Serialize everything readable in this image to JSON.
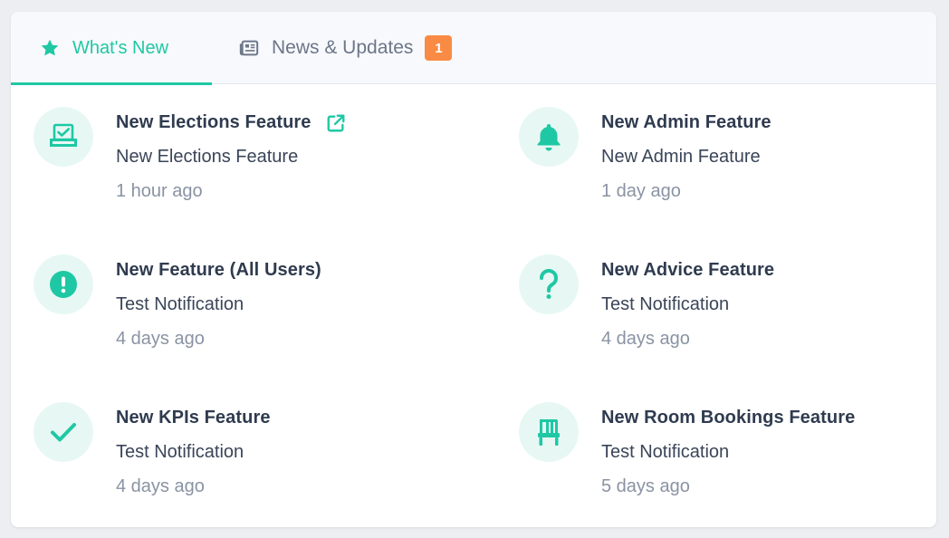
{
  "tabs": {
    "whats_new": {
      "label": "What's New",
      "icon": "star-icon",
      "active": true
    },
    "news": {
      "label": "News & Updates",
      "icon": "newspaper-icon",
      "badge": "1"
    }
  },
  "colors": {
    "accent": "#1fc8a4",
    "badge": "#f98b45",
    "icon_bg": "#e7f8f4"
  },
  "items": [
    {
      "title": "New Elections Feature",
      "description": "New Elections Feature",
      "time": "1 hour ago",
      "icon": "ballot-box-icon",
      "external_link": true
    },
    {
      "title": "New Admin Feature",
      "description": "New Admin Feature",
      "time": "1 day ago",
      "icon": "bell-icon"
    },
    {
      "title": "New Feature (All Users)",
      "description": "Test Notification",
      "time": "4 days ago",
      "icon": "exclamation-circle-icon"
    },
    {
      "title": "New Advice Feature",
      "description": "Test Notification",
      "time": "4 days ago",
      "icon": "question-mark-icon"
    },
    {
      "title": "New KPIs Feature",
      "description": "Test Notification",
      "time": "4 days ago",
      "icon": "checkmark-icon"
    },
    {
      "title": "New Room Bookings Feature",
      "description": "Test Notification",
      "time": "5 days ago",
      "icon": "chair-icon"
    }
  ]
}
